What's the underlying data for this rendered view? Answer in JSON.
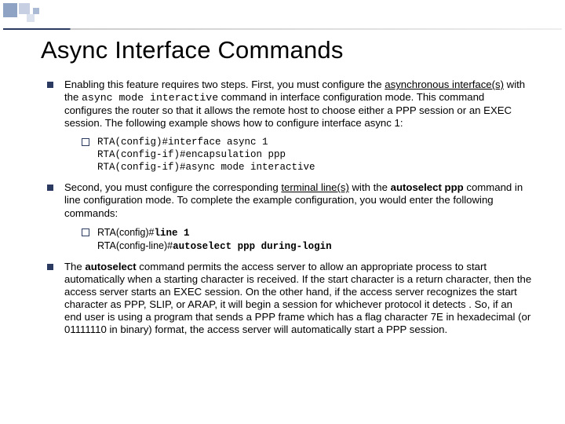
{
  "title": "Async Interface Commands",
  "bullets": {
    "b1": {
      "t1": "Enabling this feature requires two steps. First, you must configure the ",
      "t2": "asynchronous interface(s)",
      "t3": " with the ",
      "t4": "async mode interactive",
      "t5": " command in interface configuration mode. This command configures the router so that it allows the remote host to choose either a PPP session or an EXEC session. The following example shows how to configure interface async 1:",
      "sub": {
        "l1": "RTA(config)#interface async 1",
        "l2": "RTA(config-if)#encapsulation ppp",
        "l3": "RTA(config-if)#async mode interactive"
      }
    },
    "b2": {
      "t1": "Second, you must configure the corresponding ",
      "t2": "terminal line(s)",
      "t3": " with the ",
      "t4": "autoselect ppp",
      "t5": " command in line configuration mode. To complete the example configuration, you would enter the following commands:",
      "sub": {
        "l1a": "RTA(config)#",
        "l1b": "line 1",
        "l2a": "RTA(config-line)#",
        "l2b": "autoselect ppp during-login"
      }
    },
    "b3": {
      "t1": "The ",
      "t2": "autoselect",
      "t3": " command permits the access server to allow an appropriate process to start automatically when a starting character is received. If the start character is a return character, then the access server starts an EXEC session. On the other hand, if the access server recognizes the start character as PPP, SLIP, or ARAP, it will begin a session for whichever protocol it detects  . So, if an end user is using a program that sends a PPP frame which has a flag character 7E in hexadecimal (or 01111110 in binary) format, the access server will automatically start a PPP session."
    }
  }
}
